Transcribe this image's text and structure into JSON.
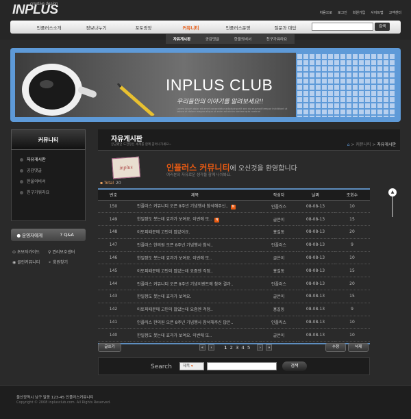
{
  "header": {
    "logo": "INPLUS",
    "logo_tag": "creative design",
    "util_links": [
      "처음으로",
      "로그인",
      "회원가입",
      "사이트맵",
      "고객센터"
    ],
    "nav": [
      "인플러스소개",
      "정보나누기",
      "포토광장",
      "커뮤니티",
      "인플러스운영",
      "질문과 대답"
    ],
    "nav_active": 3,
    "search_button": "검색",
    "subnav": [
      "자유게시판",
      "공감댓글",
      "한울의비서",
      "친구가워라요"
    ]
  },
  "banner": {
    "title": "INPLUS CLUB",
    "slogan": "우리들만의 이야기를 알려보세요!!",
    "text": "Lorem ipsum dolor sit amet consectetur adipiscing elit sed do eiusmod tempor incididunt ut labore et dolore magna aliqua ut enim ad minim veniam quis nostrud"
  },
  "sidebar": {
    "title": "커뮤니티",
    "items": [
      "자유게시판",
      "공감댓글",
      "한울의비서",
      "친구가워라요"
    ],
    "buttons": [
      "운영자에게",
      "Q&A"
    ],
    "links": [
      "초보자가이드",
      "권리보호센터",
      "클린커뮤니티",
      "회원찾기"
    ]
  },
  "main": {
    "title": "자유게시판",
    "desc": "궁금했던 도전정신 세계를 함께 뽐어나가세요~",
    "breadcrumb": [
      "커뮤니티",
      "자유게시판"
    ],
    "welcome_logo": "inplus",
    "welcome_highlight": "인플러스 커뮤니티",
    "welcome_rest": "에 오신것을 환영합니다",
    "welcome_sub": "여러분의 자유로운 생각을 함께 나눠봐요.",
    "total_label": "Total",
    "total_value": "20",
    "columns": [
      "번호",
      "제목",
      "작성자",
      "날짜",
      "조회수"
    ],
    "rows": [
      {
        "no": "150",
        "title": "인플러스 커뮤니티 오픈 8주년 기념행사 참석해주신..",
        "new": true,
        "author": "인플러스",
        "date": "08-08-13",
        "views": "10"
      },
      {
        "no": "149",
        "title": "한일정도 봇는데 효과가 보여요. 이번에 또..",
        "new": true,
        "author": "글쓴이",
        "date": "08-08-13",
        "views": "15"
      },
      {
        "no": "148",
        "title": "아토피때문에 고민이 많았어요.",
        "new": false,
        "author": "홍길동",
        "date": "08-08-13",
        "views": "20"
      },
      {
        "no": "147",
        "title": "인플러스 한의원 오픈 8주년 기념행사 참석..",
        "new": false,
        "author": "인플러스",
        "date": "08-08-13",
        "views": "9"
      },
      {
        "no": "146",
        "title": "한일정도 봇는데 효과가 보여요. 이번에 또..",
        "new": false,
        "author": "글쓴이",
        "date": "08-08-13",
        "views": "10"
      },
      {
        "no": "145",
        "title": "아토피때문에 고민이 많았는데 요즘엔 걱정..",
        "new": false,
        "author": "홍길동",
        "date": "08-08-13",
        "views": "15"
      },
      {
        "no": "144",
        "title": "인플러스 커뮤니티 오픈 8주년 기념이벤트에 참여 결과..",
        "new": false,
        "author": "인플러스",
        "date": "08-08-13",
        "views": "20"
      },
      {
        "no": "143",
        "title": "한일정도 봇는데 효과가 보여요.",
        "new": false,
        "author": "글쓴이",
        "date": "08-08-13",
        "views": "15"
      },
      {
        "no": "142",
        "title": "아토피때문에 고민이 많았는데 요즘엔 걱정..",
        "new": false,
        "author": "홍길동",
        "date": "08-08-13",
        "views": "9"
      },
      {
        "no": "141",
        "title": "인플러스 한의원 오픈 8주년 기념행사 참석해주신 많은..",
        "new": false,
        "author": "인플러스",
        "date": "08-08-13",
        "views": "10"
      },
      {
        "no": "140",
        "title": "한일정도 봇는데 효과가 보여요. 이번에 또..",
        "new": false,
        "author": "글쓴이",
        "date": "08-08-13",
        "views": "10"
      }
    ],
    "write_button": "글쓰기",
    "edit_button": "수정",
    "delete_button": "삭제",
    "pages": [
      "1",
      "2",
      "3",
      "4",
      "5"
    ],
    "search_label": "Search",
    "search_select": "제목",
    "search_button": "검색"
  },
  "footer": {
    "address": "울산광역시 남구 달동 123-45 인플러스커뮤니티",
    "copyright": "Copyright © 2008 inplusclub.com. All Rights Reserved."
  },
  "colors": {
    "accent": "#e85a12",
    "blue": "#5e9ad8",
    "bg": "#2a2a2a"
  }
}
